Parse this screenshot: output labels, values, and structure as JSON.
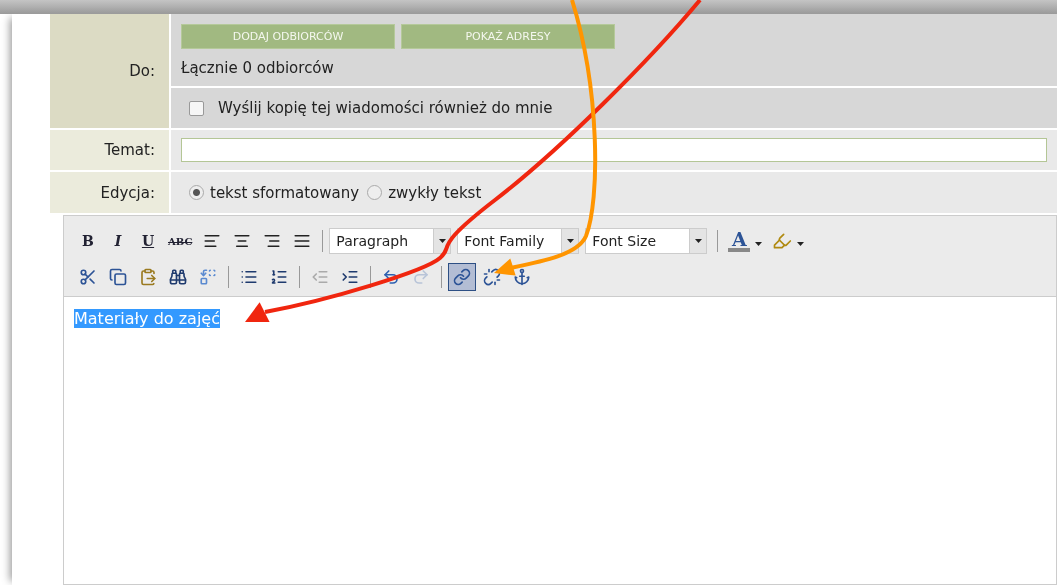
{
  "recipients": {
    "label": "Do:",
    "buttons": [
      "DODAJ ODBIORCÓW",
      "POKAŻ ADRESY"
    ],
    "count": "Łącznie 0 odbiorców",
    "copy_to_me": {
      "label": "Wyślij kopię tej wiadomości również do mnie",
      "checked": false
    }
  },
  "subject": {
    "label": "Temat:"
  },
  "edit_mode": {
    "label": "Edycja:",
    "options": [
      {
        "label": "tekst sformatowany",
        "selected": true
      },
      {
        "label": "zwykły tekst",
        "selected": false
      }
    ]
  },
  "toolbar": [
    [
      {
        "kind": "bold",
        "label": "B"
      },
      {
        "kind": "italic",
        "label": "I"
      },
      {
        "kind": "underline",
        "label": "U"
      },
      {
        "kind": "strike",
        "label": "ABC"
      },
      {
        "kind": "alignleft"
      },
      {
        "kind": "aligncenter"
      },
      {
        "kind": "alignright"
      },
      {
        "kind": "justify"
      },
      {
        "kind": "separator"
      },
      {
        "kind": "select",
        "label": "Paragraph"
      },
      {
        "kind": "select",
        "label": "Font Family"
      },
      {
        "kind": "select",
        "label": "Font Size"
      },
      {
        "kind": "separator"
      },
      {
        "kind": "forecolor",
        "label": "A"
      },
      {
        "kind": "highlight"
      }
    ],
    [
      {
        "kind": "cut"
      },
      {
        "kind": "copy"
      },
      {
        "kind": "paste"
      },
      {
        "kind": "find"
      },
      {
        "kind": "replace"
      },
      {
        "kind": "separator"
      },
      {
        "kind": "bullets"
      },
      {
        "kind": "numbers"
      },
      {
        "kind": "separator"
      },
      {
        "kind": "outdent"
      },
      {
        "kind": "indent"
      },
      {
        "kind": "separator"
      },
      {
        "kind": "undo"
      },
      {
        "kind": "redo"
      },
      {
        "kind": "separator"
      },
      {
        "kind": "link",
        "active": true
      },
      {
        "kind": "unlink"
      },
      {
        "kind": "anchor"
      }
    ]
  ],
  "editor": {
    "text": "Materiały do zajęć",
    "selected": true
  },
  "annotations": [
    {
      "color": "#f0260f"
    },
    {
      "color": "#ff9500"
    }
  ]
}
